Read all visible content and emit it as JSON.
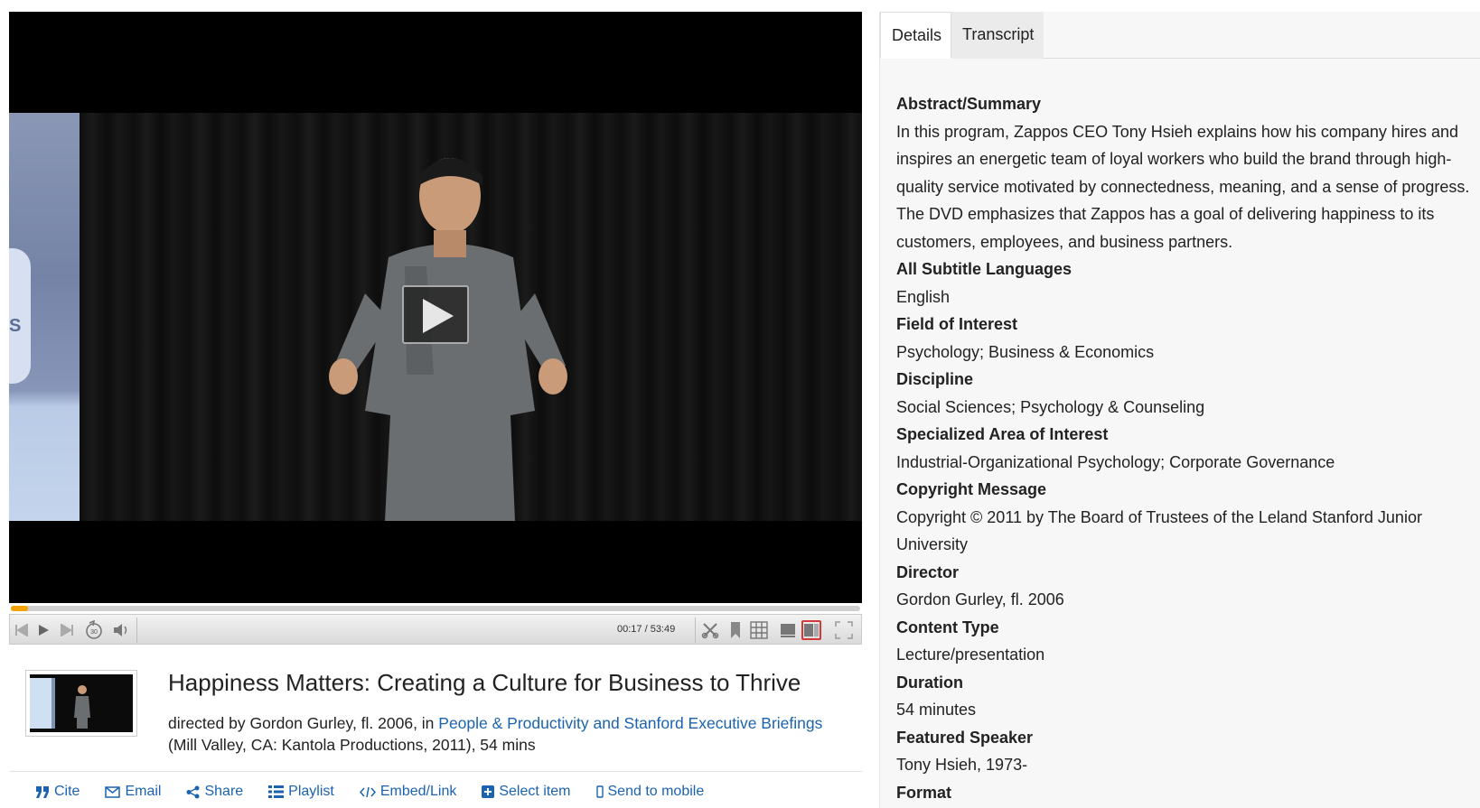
{
  "player": {
    "time_display": "00:17 / 53:49",
    "progress_fraction": 0.0053,
    "play_overlay_icon": "play-icon",
    "accent_color": "#f5a100"
  },
  "slide_text": "S",
  "video": {
    "title": "Happiness Matters: Creating a Culture for Business to Thrive",
    "byline_prefix": "directed by Gordon Gurley, fl. 2006, in ",
    "series_link": "People & Productivity and Stanford Executive Briefings",
    "byline_suffix": "(Mill Valley, CA: Kantola Productions, 2011), 54 mins"
  },
  "actions": [
    {
      "label": "Cite",
      "icon": "quote-icon"
    },
    {
      "label": "Email",
      "icon": "envelope-icon"
    },
    {
      "label": "Share",
      "icon": "share-icon"
    },
    {
      "label": "Playlist",
      "icon": "list-icon"
    },
    {
      "label": "Embed/Link",
      "icon": "code-icon"
    },
    {
      "label": "Select item",
      "icon": "plus-square-icon"
    },
    {
      "label": "Send to mobile",
      "icon": "mobile-icon"
    }
  ],
  "tabs": {
    "details": "Details",
    "transcript": "Transcript"
  },
  "details": [
    {
      "label": "Abstract/Summary",
      "value": "In this program, Zappos CEO Tony Hsieh explains how his company hires and inspires an energetic team of loyal workers who build the brand through high-quality service motivated by connectedness, meaning, and a sense of progress. The DVD emphasizes that Zappos has a goal of delivering happiness to its customers, employees, and business partners."
    },
    {
      "label": "All Subtitle Languages",
      "value": "English"
    },
    {
      "label": "Field of Interest",
      "value": "Psychology; Business & Economics"
    },
    {
      "label": "Discipline",
      "value": "Social Sciences; Psychology & Counseling"
    },
    {
      "label": "Specialized Area of Interest",
      "value": "Industrial-Organizational Psychology; Corporate Governance"
    },
    {
      "label": "Copyright Message",
      "value": "Copyright © 2011 by The Board of Trustees of the Leland Stanford Junior University"
    },
    {
      "label": "Director",
      "value": "Gordon Gurley, fl. 2006"
    },
    {
      "label": "Content Type",
      "value": "Lecture/presentation"
    },
    {
      "label": "Duration",
      "value": "54 minutes"
    },
    {
      "label": "Featured Speaker",
      "value": "Tony Hsieh, 1973-"
    },
    {
      "label": "Format",
      "value": ""
    }
  ]
}
